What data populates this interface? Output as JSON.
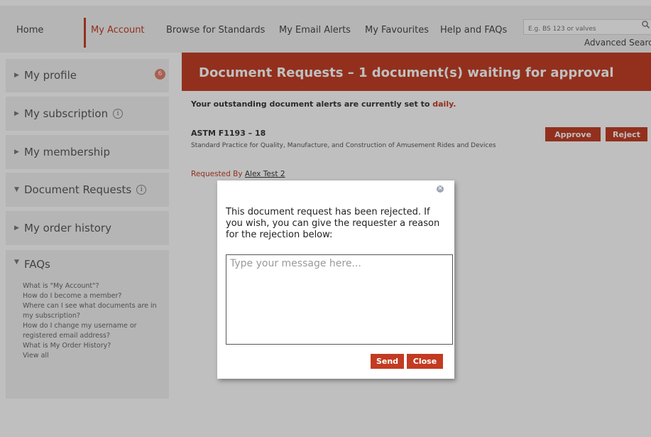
{
  "nav": {
    "items": [
      "Home",
      "My Account",
      "Browse for Standards",
      "My Email Alerts",
      "My Favourites",
      "Help and FAQs"
    ],
    "active": "My Account",
    "search_placeholder": "E.g. BS 123 or valves",
    "advanced_search": "Advanced Search"
  },
  "sidebar": {
    "items": [
      {
        "label": "My profile",
        "badge": "6"
      },
      {
        "label": "My subscription",
        "info": "i"
      },
      {
        "label": "My membership"
      },
      {
        "label": "Document Requests",
        "info": "i"
      },
      {
        "label": "My order history"
      },
      {
        "label": "FAQs"
      }
    ],
    "faqs": [
      "What is \"My Account\"?",
      "How do I become a member?",
      "Where can I see what documents are in my subscription?",
      "How do I change my username or registered email address?",
      "What is My Order History?",
      "View all"
    ]
  },
  "main": {
    "banner_title": "Document Requests – 1 document(s) waiting for approval",
    "alert_text": "Your outstanding document alerts are currently set to",
    "alert_frequency": "daily.",
    "document": {
      "code": "ASTM F1193 – 18",
      "description": "Standard Practice for Quality, Manufacture, and Construction of Amusement Rides and Devices",
      "requested_by_label": "Requested By",
      "requested_by_name": "Alex Test 2"
    },
    "approve_label": "Approve",
    "reject_label": "Reject"
  },
  "modal": {
    "message": "This document request has been rejected. If you wish, you can give the requester a reason for the rejection below:",
    "placeholder": "Type your message here...",
    "send_label": "Send",
    "close_label": "Close",
    "close_icon": "close-icon"
  },
  "colors": {
    "accent": "#c23b22",
    "nav_bg": "#f1f1f1",
    "overlay": "rgba(20,20,20,0.27)"
  }
}
